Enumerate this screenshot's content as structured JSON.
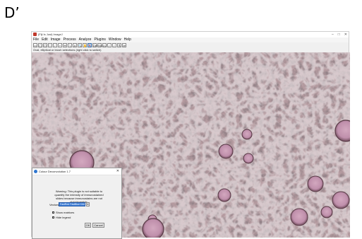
{
  "panel_label": "D’",
  "app": {
    "title": "(Fiji Is Just) ImageJ",
    "window_controls": [
      "–",
      "□",
      "✕"
    ],
    "menu": [
      "File",
      "Edit",
      "Image",
      "Process",
      "Analyze",
      "Plugins",
      "Window",
      "Help"
    ],
    "tools": [
      "▭",
      "◯",
      "⬠",
      "♡",
      "∕",
      "⌐",
      "✛",
      "∖",
      "A",
      "🔍",
      "✋",
      "✎",
      "Dev",
      "Stk",
      "LUT",
      "⁄",
      "⁄",
      "⚗",
      "≫"
    ],
    "active_tool_index": 11,
    "status": "Oval, elliptical or brush selections (right click to switch)"
  },
  "dialog": {
    "title": "Colour Deconvolution 1.7",
    "close": "✕",
    "warning": "Warning: This plugin is not suitable to quantify the intensity of immunostained slides because immunostains are not stoichiometric.",
    "vectors_label": "Vectors",
    "vectors_value": "FastRed FastBlue DAB",
    "checkboxes": [
      "Show matrices",
      "Hide legend"
    ],
    "ok_label": "OK",
    "cancel_label": "Cancel"
  },
  "colors": {
    "tissue_base": "#b49a9f",
    "cell_body": "#c79cb3",
    "selection_blue": "#3a7bd5"
  }
}
